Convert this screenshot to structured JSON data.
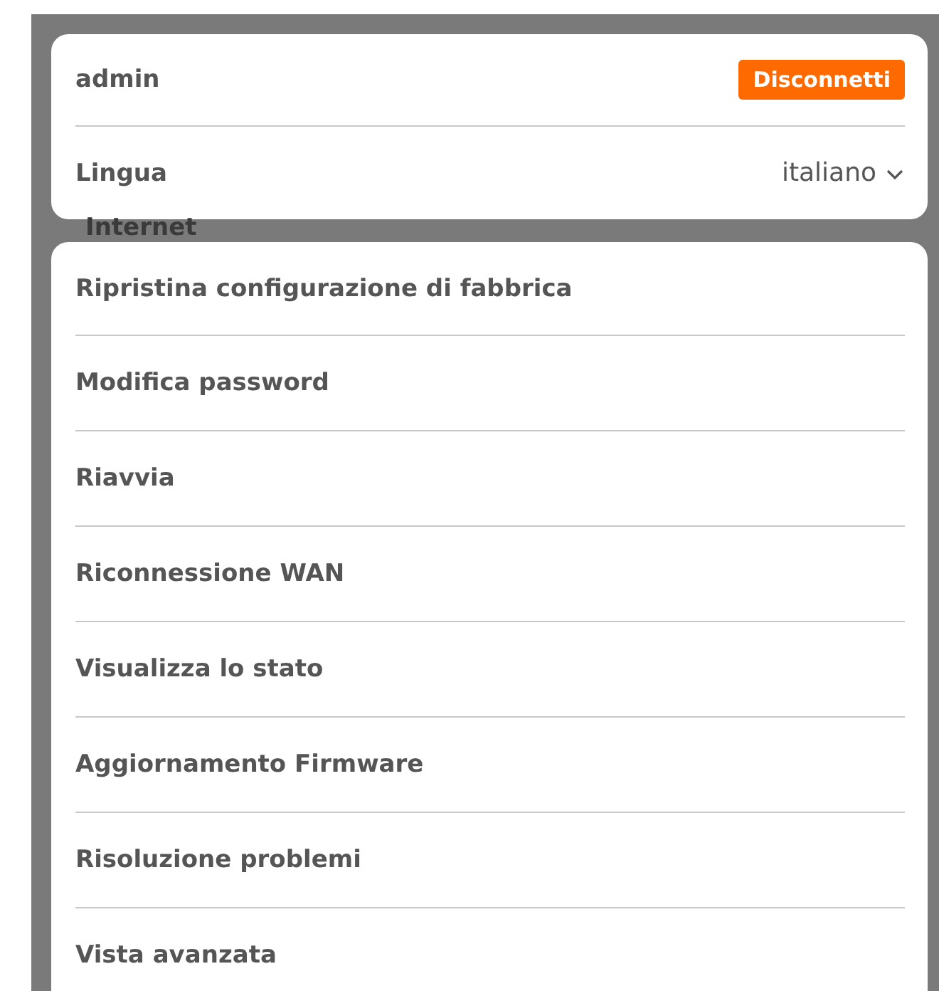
{
  "account": {
    "user": "admin",
    "logout_button": "Disconnetti",
    "language_label": "Lingua",
    "language_value": "italiano"
  },
  "background_section": {
    "title": "Internet"
  },
  "menu": {
    "items": [
      {
        "label": "Ripristina configurazione di fabbrica"
      },
      {
        "label": "Modifica password"
      },
      {
        "label": "Riavvia"
      },
      {
        "label": "Riconnessione WAN"
      },
      {
        "label": "Visualizza lo stato"
      },
      {
        "label": "Aggiornamento Firmware"
      },
      {
        "label": "Risoluzione problemi"
      },
      {
        "label": "Vista avanzata"
      }
    ]
  }
}
